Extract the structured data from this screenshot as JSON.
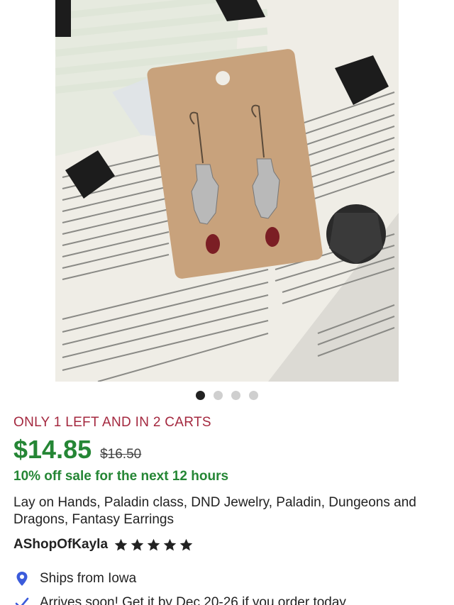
{
  "image": {
    "description_icon": "product-photo",
    "colors": {
      "card": "#c8a27c",
      "paper": "#f1efe8",
      "gem": "#7b1e24",
      "metal": "#b9b9b9"
    }
  },
  "carousel": {
    "count": 4,
    "active_index": 0
  },
  "listing": {
    "stock_notice": "ONLY 1 LEFT AND IN 2 CARTS",
    "price": "$14.85",
    "original_price": "$16.50",
    "sale_text": "10% off sale for the next 12 hours",
    "title": "Lay on Hands, Paladin class, DND Jewelry, Paladin, Dungeons and Dragons, Fantasy Earrings",
    "shop_name": "AShopOfKayla",
    "rating": 5
  },
  "shipping": {
    "ships_from": "Ships from Iowa",
    "arrival": "Arrives soon! Get it by Dec 20-26 if you order today"
  },
  "colors": {
    "stock": "#a4283f",
    "price": "#258635",
    "pin": "#3b5bdb",
    "check": "#3b5bdb",
    "star": "#222222"
  }
}
